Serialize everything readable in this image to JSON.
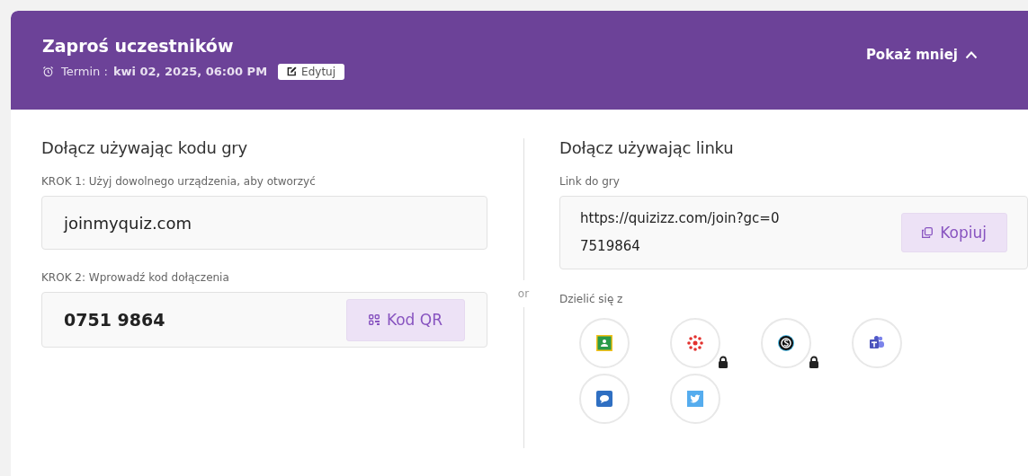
{
  "header": {
    "title": "Zaproś uczestników",
    "deadline_label": "Termin :",
    "deadline_value": "kwi 02, 2025, 06:00 PM",
    "edit_button": "Edytuj",
    "toggle": "Pokaż mniej",
    "expanded": true
  },
  "code_section": {
    "heading": "Dołącz używając kodu gry",
    "step1_label": "KROK 1: Użyj dowolnego urządzenia, aby otworzyć",
    "step1_value": "joinmyquiz.com",
    "step2_label": "KROK 2: Wprowadź kod dołączenia",
    "step2_value": "0751 9864",
    "qr_button": "Kod QR"
  },
  "separator": "or",
  "link_section": {
    "heading": "Dołącz używając linku",
    "link_label": "Link do gry",
    "link_value": "https://quizizz.com/join?gc=07519864",
    "copy_button": "Kopiuj",
    "share_label": "Dzielić się z",
    "share_targets": [
      {
        "kind": "classroom",
        "locked": false
      },
      {
        "kind": "canvas",
        "locked": true
      },
      {
        "kind": "schoology",
        "locked": true
      },
      {
        "kind": "teams",
        "locked": false
      },
      {
        "kind": "remind",
        "locked": false
      },
      {
        "kind": "twitter",
        "locked": false
      }
    ]
  }
}
